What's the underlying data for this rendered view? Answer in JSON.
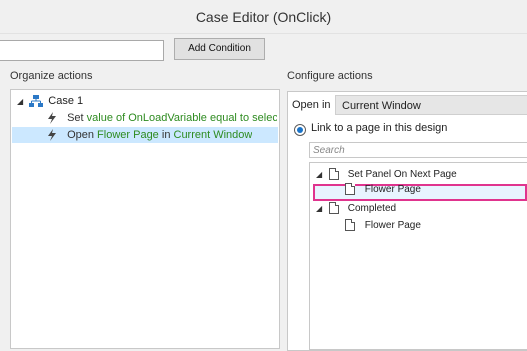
{
  "window": {
    "title": "Case Editor (OnClick)"
  },
  "toolbar": {
    "condition_value": "",
    "add_condition_label": "Add Condition"
  },
  "organize": {
    "heading": "Organize actions",
    "case_label": "Case 1",
    "action1": {
      "verb": "Set",
      "detail": "value of OnLoadVariable equal to selected op"
    },
    "action2": {
      "verb": "Open",
      "target": "Flower Page",
      "in_word": "in",
      "where": "Current Window"
    }
  },
  "configure": {
    "heading": "Configure actions",
    "open_in_label": "Open in",
    "open_in_value": "Current Window",
    "radio_label": "Link to a page in this design",
    "search_placeholder": "Search",
    "tree": [
      {
        "label": "Set Panel On Next Page",
        "expanded": true,
        "children": [
          "Flower Page"
        ]
      },
      {
        "label": "Completed",
        "expanded": true,
        "children": [
          "Flower Page"
        ]
      }
    ]
  }
}
